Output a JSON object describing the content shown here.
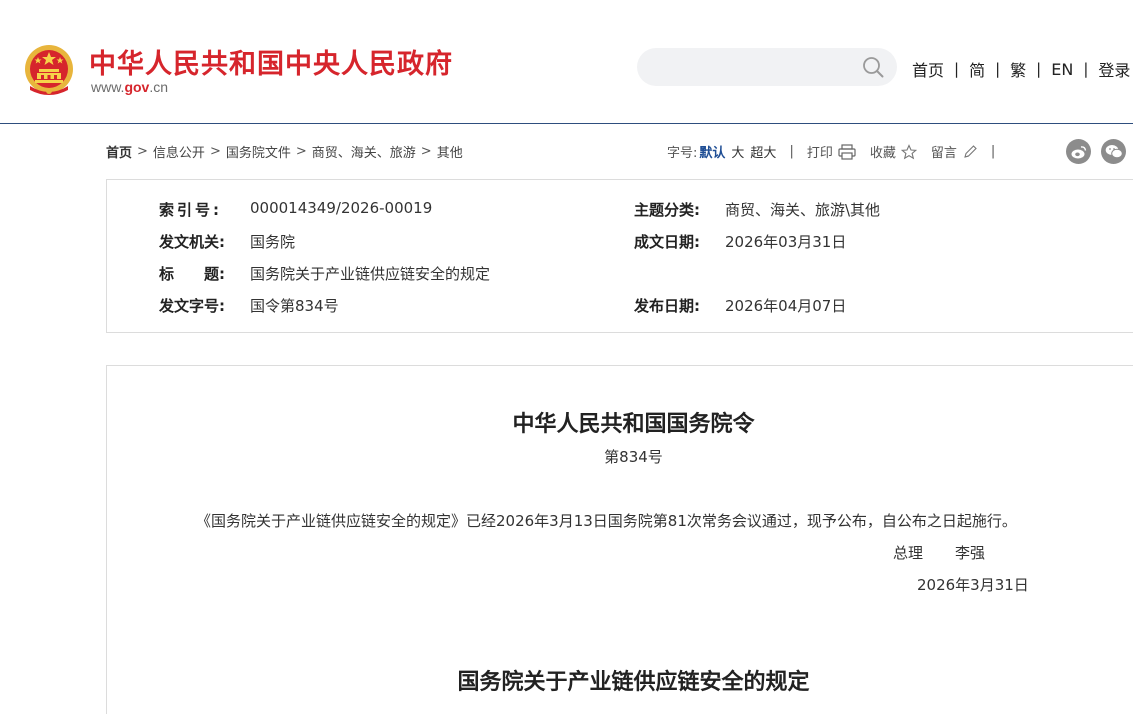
{
  "header": {
    "site_title": "中华人民共和国中央人民政府",
    "domain_prefix": "www.",
    "domain_main": "gov",
    "domain_suffix": ".cn",
    "nav": [
      "首页",
      "简",
      "繁",
      "EN",
      "登录"
    ],
    "nav_sep": "|",
    "search_icon": "search-icon",
    "brand_color": "#d6252c"
  },
  "breadcrumb": {
    "items": [
      "首页",
      "信息公开",
      "国务院文件",
      "商贸、海关、旅游",
      "其他"
    ],
    "sep": ">"
  },
  "tools": {
    "font_label": "字号:",
    "font_default": "默认",
    "font_large": "大",
    "font_xlarge": "超大",
    "print": "打印",
    "favorite": "收藏",
    "comment": "留言",
    "sep": "|",
    "social_icons": [
      "weibo-icon",
      "wechat-icon"
    ]
  },
  "info": {
    "index_label": "索引号:",
    "index_value": "000014349/2026-00019",
    "category_label": "主题分类:",
    "category_value": "商贸、海关、旅游\\其他",
    "issuer_label": "发文机关:",
    "issuer_value": "国务院",
    "written_label": "成文日期:",
    "written_value": "2026年03月31日",
    "title_label": "标　　题:",
    "title_value": "国务院关于产业链供应链安全的规定",
    "docno_label": "发文字号:",
    "docno_value": "国令第834号",
    "published_label": "发布日期:",
    "published_value": "2026年04月07日"
  },
  "doc": {
    "heading": "中华人民共和国国务院令",
    "number": "第834号",
    "paragraph": "《国务院关于产业链供应链安全的规定》已经2026年3月13日国务院第81次常务会议通过，现予公布，自公布之日起施行。",
    "signer_title": "总理",
    "signer_name": "李强",
    "date": "2026年3月31日",
    "rule_title": "国务院关于产业链供应链安全的规定"
  }
}
